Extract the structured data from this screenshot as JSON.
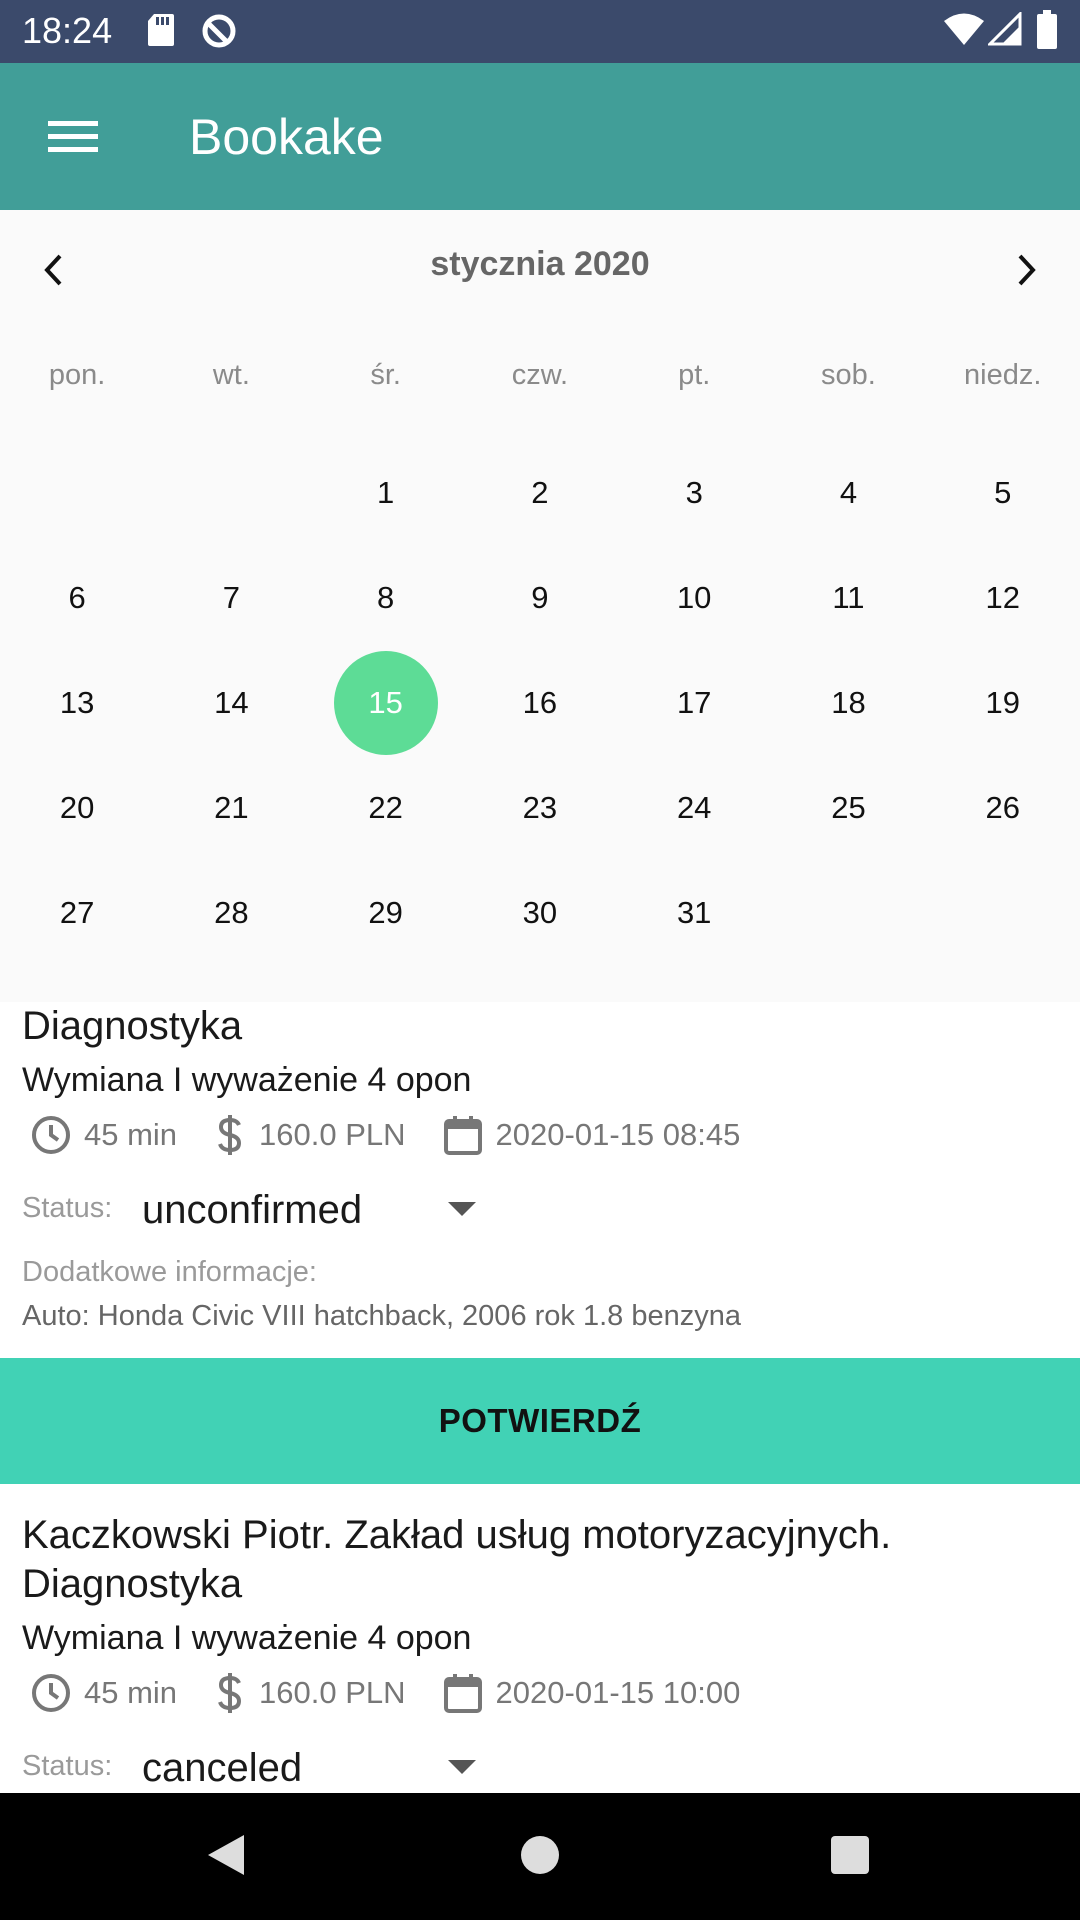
{
  "status_bar": {
    "time": "18:24"
  },
  "app_bar": {
    "title": "Bookake"
  },
  "calendar": {
    "month_label": "stycznia 2020",
    "weekdays": [
      "pon.",
      "wt.",
      "śr.",
      "czw.",
      "pt.",
      "sob.",
      "niedz."
    ],
    "days": [
      "",
      "",
      "1",
      "2",
      "3",
      "4",
      "5",
      "6",
      "7",
      "8",
      "9",
      "10",
      "11",
      "12",
      "13",
      "14",
      "15",
      "16",
      "17",
      "18",
      "19",
      "20",
      "21",
      "22",
      "23",
      "24",
      "25",
      "26",
      "27",
      "28",
      "29",
      "30",
      "31",
      "",
      ""
    ],
    "selected_day": "15",
    "selected_color": "#5ddc96"
  },
  "appointments": [
    {
      "title": "Diagnostyka",
      "service": "Wymiana I wyważenie 4 opon",
      "duration": "45 min",
      "price": "160.0 PLN",
      "datetime": "2020-01-15 08:45",
      "status_label": "Status:",
      "status": "unconfirmed",
      "info_label": "Dodatkowe informacje:",
      "info": "Auto: Honda Civic VIII hatchback, 2006 rok 1.8 benzyna",
      "confirm_label": "POTWIERDŹ"
    },
    {
      "title_line1": "Kaczkowski Piotr. Zakład usług motoryzacyjnych.",
      "title_line2": "Diagnostyka",
      "service": "Wymiana I wyważenie 4 opon",
      "duration": "45 min",
      "price": "160.0 PLN",
      "datetime": "2020-01-15 10:00",
      "status_label": "Status:",
      "status": "canceled"
    }
  ],
  "colors": {
    "status_bar": "#3b4a6b",
    "app_bar": "#419e98",
    "confirm_button": "#41d2b5"
  },
  "icons": [
    "menu-icon",
    "chevron-left-icon",
    "chevron-right-icon",
    "clock-icon",
    "dollar-icon",
    "calendar-icon",
    "dropdown-caret-icon",
    "back-icon",
    "home-icon",
    "recents-icon",
    "sd-card-icon",
    "sync-icon",
    "wifi-icon",
    "signal-icon",
    "battery-icon"
  ]
}
